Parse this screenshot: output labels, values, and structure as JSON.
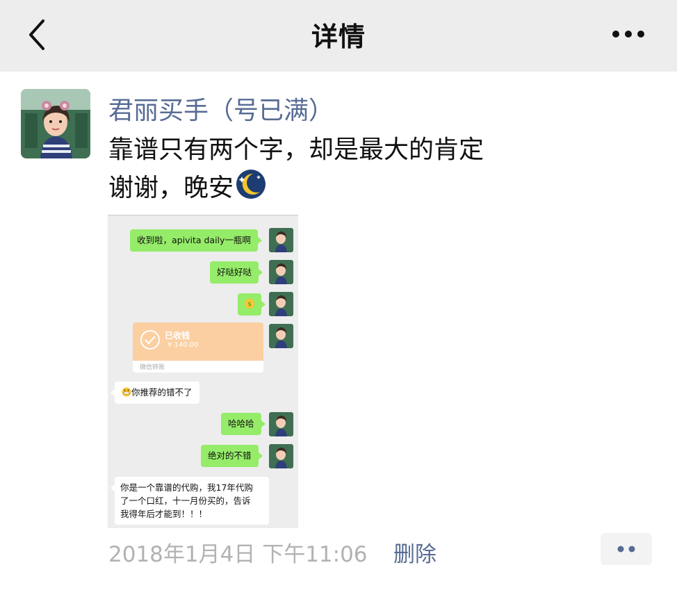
{
  "navbar": {
    "title": "详情"
  },
  "post": {
    "author": "君丽买手（号已满）",
    "text_line1": "靠谱只有两个字，却是最大的肯定",
    "text_line2": "谢谢，晚安",
    "timestamp": "2018年1月4日 下午11:06",
    "delete_label": "删除"
  },
  "chat": {
    "msg1": "收到啦，apivita daily一瓶啊",
    "msg2": "好哒好哒",
    "payment_title": "已收钱",
    "payment_amount": "¥ 140.00",
    "payment_footer": "微信转账",
    "reply1": "你推荐的错不了",
    "msg4": "哈哈哈",
    "msg5": "绝对的不错",
    "reply2_line1": "你是一个靠谱的代购，我17年代购",
    "reply2_line2": "了一个口红，十一月份买的，告诉",
    "reply2_line3": "我得年后才能到！！！"
  },
  "colors": {
    "link": "#576b95",
    "bubble_green": "#95ec69",
    "navbar_bg": "#ededed",
    "payment": "#fbcfa1"
  },
  "icons": {
    "back": "chevron-left-icon",
    "more": "more-dots-icon",
    "moon": "sleepy-moon-emoji"
  }
}
